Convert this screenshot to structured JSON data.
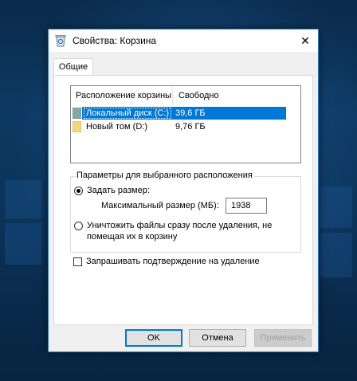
{
  "window": {
    "title": "Свойства: Корзина",
    "close_glyph": "✕",
    "icon": "recycle-bin-icon"
  },
  "tabs": [
    {
      "label": "Общие",
      "selected": true
    }
  ],
  "locations": {
    "columns": [
      "Расположение корзины",
      "Свободно"
    ],
    "rows": [
      {
        "name": "Локальный диск (C:)",
        "free": "39,6 ГБ",
        "selected": true,
        "icon": "local-disk-icon"
      },
      {
        "name": "Новый том (D:)",
        "free": "9,76 ГБ",
        "selected": false,
        "icon": "volume-icon"
      }
    ]
  },
  "settings": {
    "group_label": "Параметры для выбранного расположения",
    "custom_size_label": "Задать размер:",
    "custom_size_selected": true,
    "max_size_label": "Максимальный размер (МБ):",
    "max_size_value": "1938",
    "delete_immediately_line1": "Уничтожить файлы сразу после удаления, не",
    "delete_immediately_line2": "помещая их в корзину",
    "delete_immediately_selected": false,
    "confirm_delete_label": "Запрашивать подтверждение на удаление",
    "confirm_delete_checked": false
  },
  "buttons": {
    "ok": "OK",
    "cancel": "Отмена",
    "apply": "Применить"
  },
  "colors": {
    "accent": "#0078d7",
    "selection": "#0078d7"
  }
}
